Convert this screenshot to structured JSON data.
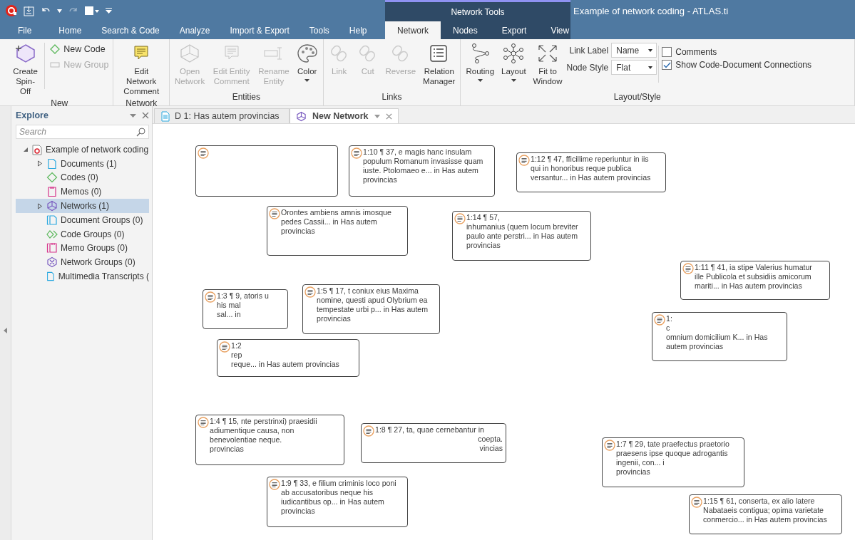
{
  "title_bar": {
    "title": "Example of network coding - ATLAS.ti",
    "context_group": "Network Tools"
  },
  "menu_tabs": [
    {
      "label": "File",
      "kind": "main",
      "selected": false
    },
    {
      "label": "Home",
      "kind": "main",
      "selected": false
    },
    {
      "label": "Search & Code",
      "kind": "main",
      "selected": false
    },
    {
      "label": "Analyze",
      "kind": "main",
      "selected": false
    },
    {
      "label": "Import & Export",
      "kind": "main",
      "selected": false
    },
    {
      "label": "Tools",
      "kind": "main",
      "selected": false
    },
    {
      "label": "Help",
      "kind": "main",
      "selected": false
    },
    {
      "label": "Network",
      "kind": "contextual",
      "selected": true
    },
    {
      "label": "Nodes",
      "kind": "contextual",
      "selected": false
    },
    {
      "label": "Export",
      "kind": "contextual",
      "selected": false
    },
    {
      "label": "View",
      "kind": "contextual",
      "selected": false
    }
  ],
  "ribbon": {
    "groups": [
      {
        "label": "New",
        "items": [
          {
            "kind": "large",
            "label": "Create Spin-Off",
            "disabled": false,
            "has_menu": false
          },
          {
            "kind": "small",
            "label": "New Code",
            "disabled": false
          },
          {
            "kind": "small",
            "label": "New Group",
            "disabled": true
          }
        ]
      },
      {
        "label": "Network",
        "items": [
          {
            "kind": "large",
            "label": "Edit Network Comment",
            "disabled": false,
            "has_menu": false
          }
        ]
      },
      {
        "label": "Entities",
        "items": [
          {
            "kind": "large",
            "label": "Open Network",
            "disabled": true,
            "has_menu": false
          },
          {
            "kind": "large",
            "label": "Edit Entity Comment",
            "disabled": true,
            "has_menu": false
          },
          {
            "kind": "large",
            "label": "Rename Entity",
            "disabled": true,
            "has_menu": false
          },
          {
            "kind": "large",
            "label": "Color",
            "disabled": false,
            "has_menu": true
          }
        ]
      },
      {
        "label": "Links",
        "items": [
          {
            "kind": "large",
            "label": "Link",
            "disabled": true,
            "has_menu": false
          },
          {
            "kind": "large",
            "label": "Cut",
            "disabled": true,
            "has_menu": false
          },
          {
            "kind": "large",
            "label": "Reverse",
            "disabled": true,
            "has_menu": false
          },
          {
            "kind": "large",
            "label": "Relation Manager",
            "disabled": false,
            "has_menu": false
          }
        ]
      },
      {
        "label": "Layout/Style",
        "items": [
          {
            "kind": "large",
            "label": "Routing",
            "disabled": false,
            "has_menu": true
          },
          {
            "kind": "large",
            "label": "Layout",
            "disabled": false,
            "has_menu": true
          },
          {
            "kind": "large",
            "label": "Fit to Window",
            "disabled": false,
            "has_menu": false
          },
          {
            "kind": "combo",
            "label": "Link Label",
            "value": "Name"
          },
          {
            "kind": "combo",
            "label": "Node Style",
            "value": "Flat"
          },
          {
            "kind": "checkbox",
            "label": "Comments",
            "checked": false
          },
          {
            "kind": "checkbox",
            "label": "Show Code-Document Connections",
            "checked": true
          }
        ]
      }
    ]
  },
  "explore": {
    "title": "Explore",
    "search": {
      "placeholder": "Search"
    },
    "tree": [
      {
        "label": "Example of network coding",
        "kind": "project",
        "expanded": true,
        "children": [
          {
            "label": "Documents (1)",
            "kind": "document",
            "expanded": false,
            "selected": false
          },
          {
            "label": "Codes (0)",
            "kind": "code",
            "selected": false
          },
          {
            "label": "Memos (0)",
            "kind": "memo",
            "selected": false
          },
          {
            "label": "Networks (1)",
            "kind": "network",
            "expanded": false,
            "selected": true
          },
          {
            "label": "Document Groups (0)",
            "kind": "document-group",
            "selected": false
          },
          {
            "label": "Code Groups (0)",
            "kind": "code-group",
            "selected": false
          },
          {
            "label": "Memo Groups (0)",
            "kind": "memo-group",
            "selected": false
          },
          {
            "label": "Network Groups (0)",
            "kind": "network-group",
            "selected": false
          },
          {
            "label": "Multimedia Transcripts (",
            "kind": "transcript",
            "selected": false
          }
        ]
      }
    ]
  },
  "doc_tabs": [
    {
      "label": "D 1: Has autem provincias",
      "kind": "document",
      "selected": false
    },
    {
      "label": "New Network",
      "kind": "network",
      "selected": true
    }
  ],
  "network": {
    "nodes": [
      {
        "kind": "quotation"
      },
      {
        "lines": [
          "Orontes ambiens amnis imosque",
          "pedes Cassii... in Has autem",
          "provincias"
        ]
      },
      {
        "lines": [
          "1:10 ¶ 37, e magis hanc insulam",
          "populum Romanum invasisse quam",
          "iuste. Ptolomaeo e... in Has autem",
          "provincias"
        ]
      },
      {
        "lines": [
          "1:14 ¶ 57,",
          "inhumanius (quem locum breviter",
          "paulo ante perstri... in Has autem",
          "provincias"
        ]
      },
      {
        "lines": [
          "1:12 ¶ 47, fficillime reperiuntur in iis",
          "qui in honoribus reque publica",
          "versantur... in Has autem provincias"
        ]
      },
      {
        "lines": [
          "1:3 ¶ 9, atoris u",
          "his mal",
          "sal... in"
        ]
      },
      {
        "lines": [
          "1:2",
          "rep",
          "reque... in Has autem provincias"
        ]
      },
      {
        "lines": [
          "1:5 ¶ 17, t coniux eius Maxima",
          "nomine, questi apud Olybrium ea",
          "tempestate urbi p... in Has autem",
          "provincias"
        ]
      },
      {
        "lines": [
          "1:",
          "c",
          "omnium domicilium K... in Has",
          "autem provincias"
        ]
      },
      {
        "lines": [
          "1:11 ¶ 41, ia stipe Valerius humatur",
          "ille Publicola et subsidiis amicorum",
          "mariti... in Has autem provincias"
        ]
      },
      {
        "lines": [
          "1:4 ¶ 15, nte perstrinxi) praesidii",
          "adiumentique causa, non",
          "benevolentiae neque.",
          "provincias"
        ]
      },
      {
        "lines": [
          "1:8 ¶ 27, ta, quae cernebantur in",
          "coepta.",
          "vincias"
        ]
      },
      {
        "lines": [
          "1:9 ¶ 33, e filium criminis loco poni",
          "ab accusatoribus neque his",
          "iudicantibus op... in Has autem",
          "provincias"
        ]
      },
      {
        "lines": [
          "1:7 ¶ 29, tate praefectus praetorio",
          "praesens ipse quoque adrogantis",
          "ingenii, con... i",
          "provincias"
        ]
      },
      {
        "lines": [
          "1:15 ¶ 61, conserta, ex alio latere",
          "Nabataeis contigua; opima varietate",
          "conmercio... in Has autem provincias"
        ]
      }
    ]
  }
}
